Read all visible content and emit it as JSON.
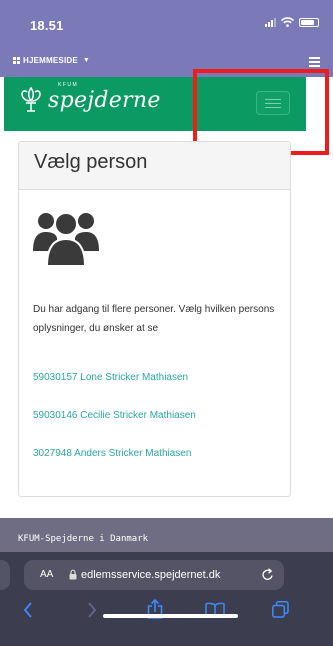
{
  "status_bar": {
    "time": "18.51"
  },
  "site_bar": {
    "home_label": "HJEMMESIDE",
    "icons": [
      "grid-icon",
      "caret-down-icon",
      "menu-icon"
    ]
  },
  "navbar": {
    "brand_small": "KFUM",
    "brand_name": "spejderne",
    "icons": [
      "fleur-de-lis-icon",
      "hamburger-icon"
    ]
  },
  "card": {
    "title": "Vælg person",
    "description": "Du har adgang til flere personer. Vælg hvilken persons oplysninger, du ønsker at se",
    "persons": [
      {
        "label": "59030157 Lone Stricker Mathiasen"
      },
      {
        "label": "59030146 Cecilie Stricker Mathiasen"
      },
      {
        "label": "3027948 Anders Stricker Mathiasen"
      }
    ]
  },
  "footer": {
    "text": "KFUM-Spejderne i Danmark"
  },
  "browser": {
    "text_size_label": "AA",
    "url": "edlemsservice.spejdernet.dk",
    "toolbar_icons": [
      "back-icon",
      "forward-icon",
      "share-icon",
      "bookmarks-icon",
      "tabs-icon"
    ]
  },
  "colors": {
    "site_bar": "#7a7ab8",
    "brand_green": "#0b9a61",
    "link": "#2aa6a0",
    "highlight": "#ee1c1c",
    "browser_bg": "#3d3d50"
  }
}
